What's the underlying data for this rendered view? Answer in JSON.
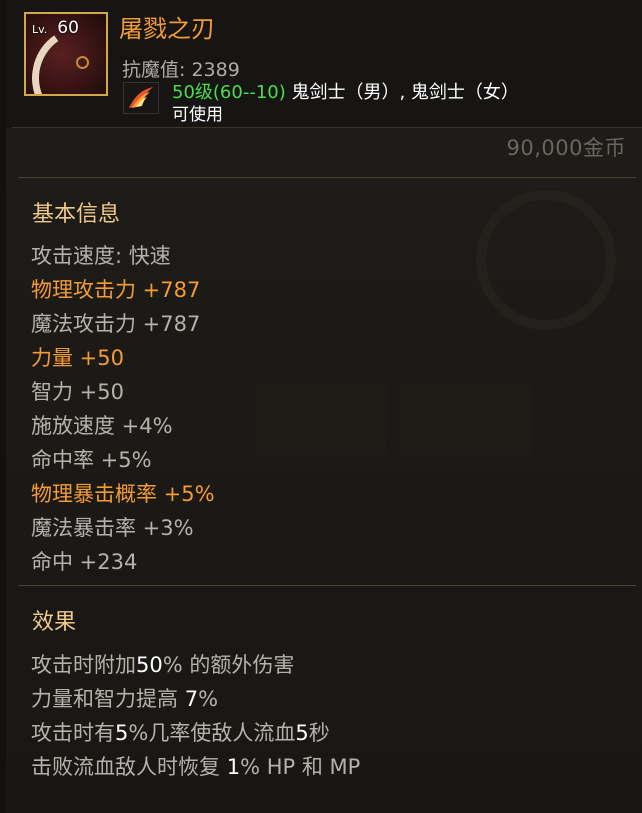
{
  "item": {
    "level_prefix": "Lv.",
    "level": "60",
    "name": "屠戮之刃",
    "anti_magic": "抗魔值: 2389",
    "requirement_level": "50级(60--10)",
    "requirement_classes": " 鬼剑士（男）, 鬼剑士（女）",
    "usable": "可使用",
    "price": "90,000金币",
    "icon": "curved-blade-icon",
    "class_icon": "flame-wing-icon"
  },
  "basic": {
    "title": "基本信息",
    "stats": [
      {
        "text": "攻击速度: 快速",
        "highlight": false
      },
      {
        "text": "物理攻击力 +787",
        "highlight": true
      },
      {
        "text": "魔法攻击力 +787",
        "highlight": false
      },
      {
        "text": "力量 +50",
        "highlight": true
      },
      {
        "text": "智力 +50",
        "highlight": false
      },
      {
        "text": "施放速度 +4%",
        "highlight": false
      },
      {
        "text": "命中率 +5%",
        "highlight": false
      },
      {
        "text": "物理暴击概率 +5%",
        "highlight": true
      },
      {
        "text": "魔法暴击率 +3%",
        "highlight": false
      },
      {
        "text": "命中 +234",
        "highlight": false
      }
    ]
  },
  "effects": {
    "title": "效果",
    "lines": [
      {
        "a": "攻击时附加",
        "b": "50",
        "c": "% 的额外伤害",
        "d": "",
        "e": ""
      },
      {
        "a": "力量和智力提高 ",
        "b": "7",
        "c": "%",
        "d": "",
        "e": ""
      },
      {
        "a": "攻击时有",
        "b": "5",
        "c": "%几率使敌人流血",
        "d": "5",
        "e": "秒"
      },
      {
        "a": "击败流血敌人时恢复 ",
        "b": "1",
        "c": "% HP 和 MP",
        "d": "",
        "e": ""
      }
    ]
  },
  "colors": {
    "highlight": "#f39b35",
    "normal": "#b6b1a9",
    "section_title": "#f0c98b",
    "requirement_green": "#4cdc4c",
    "icon_border": "#d4a84a"
  }
}
